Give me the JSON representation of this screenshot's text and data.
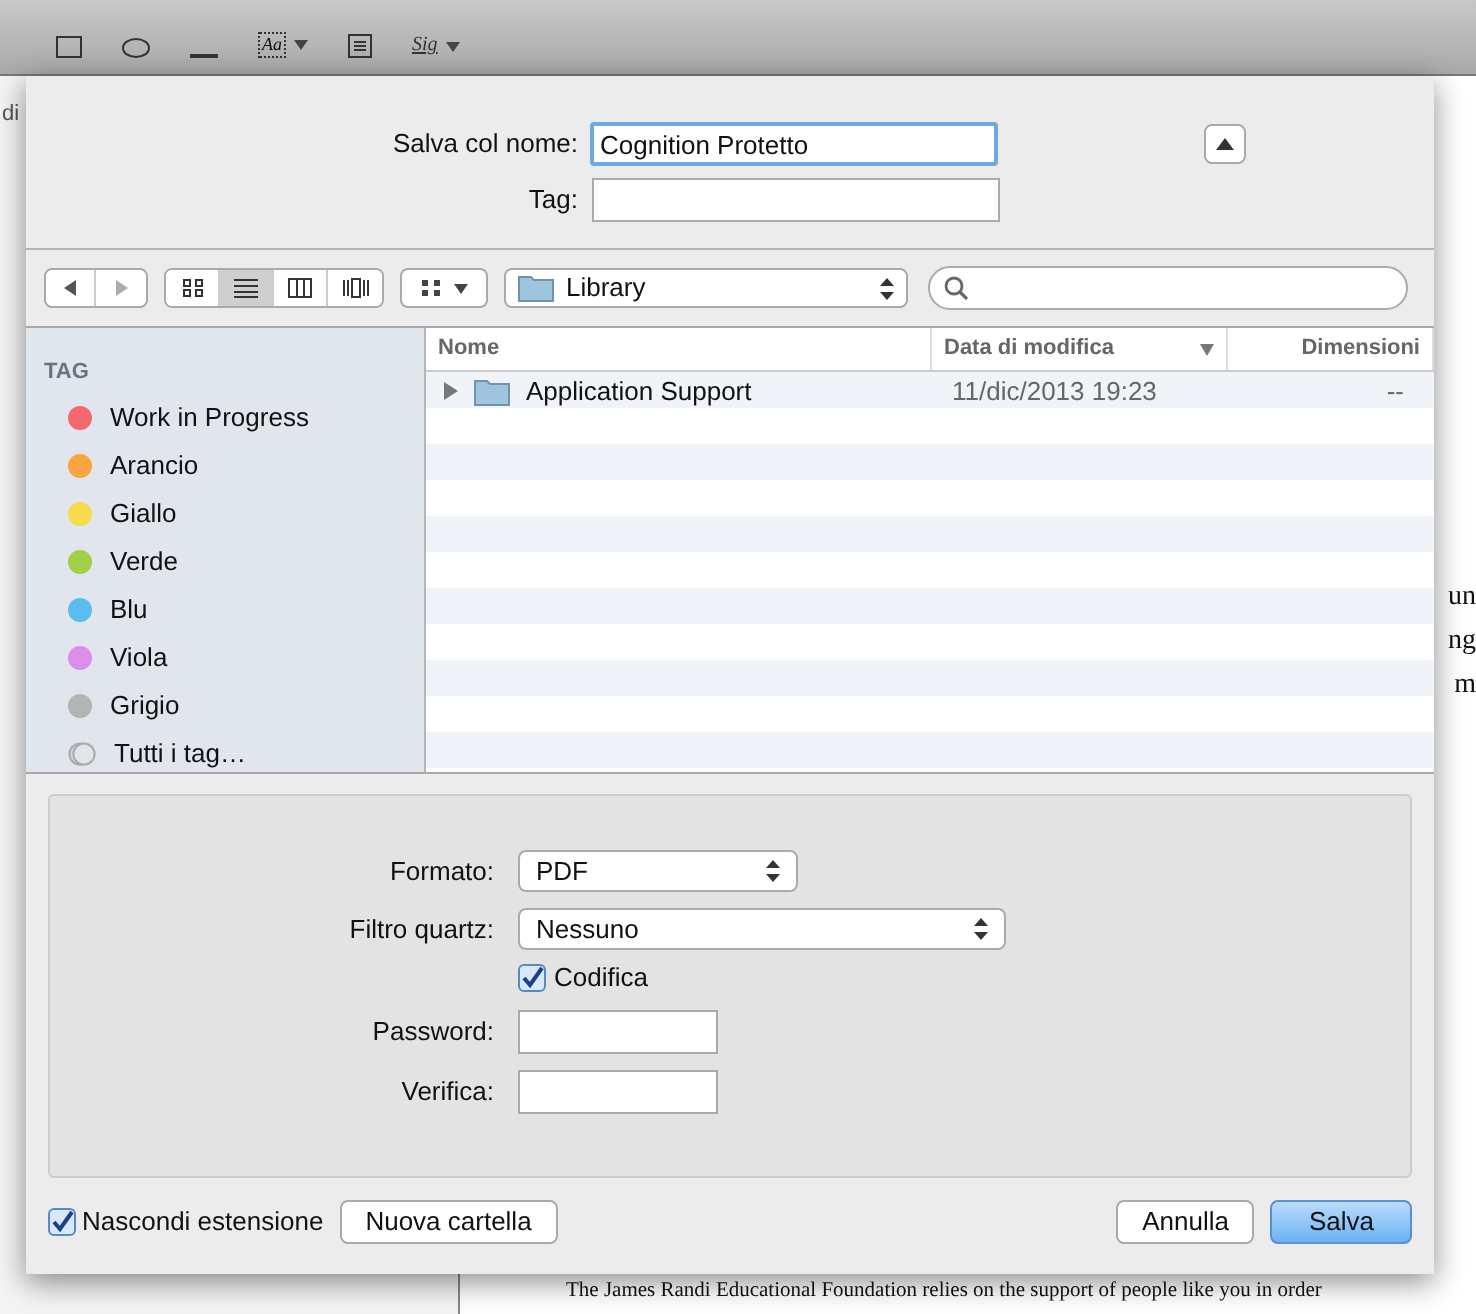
{
  "app_toolbar": {
    "text_tool": "Aa",
    "signature_tool": "Sig"
  },
  "document": {
    "sidebar_fragment": "di",
    "right_fragments": [
      "un",
      "ng",
      "m"
    ],
    "footer_line": "The James Randi Educational Foundation relies on the support of people like you in order"
  },
  "dialog": {
    "name_label": "Salva col nome:",
    "name_value": "Cognition Protetto",
    "tag_label": "Tag:",
    "view_modes": [
      {
        "kind": "icons",
        "selected": false
      },
      {
        "kind": "list",
        "selected": true
      },
      {
        "kind": "columns",
        "selected": false
      },
      {
        "kind": "coverflow",
        "selected": false
      }
    ],
    "location": "Library",
    "sidebar": {
      "heading": "TAG",
      "items": [
        {
          "label": "Work in Progress",
          "color": "#f26a6f",
          "kind": "tag"
        },
        {
          "label": "Arancio",
          "color": "#f9a43f",
          "kind": "tag"
        },
        {
          "label": "Giallo",
          "color": "#f7db4b",
          "kind": "tag"
        },
        {
          "label": "Verde",
          "color": "#a3cf48",
          "kind": "tag"
        },
        {
          "label": "Blu",
          "color": "#5bbcf2",
          "kind": "tag"
        },
        {
          "label": "Viola",
          "color": "#dd8ee9",
          "kind": "tag"
        },
        {
          "label": "Grigio",
          "color": "#b4b4b4",
          "kind": "tag"
        },
        {
          "label": "Tutti i tag…",
          "kind": "all"
        }
      ]
    },
    "columns": [
      {
        "label": "Nome",
        "sorted": false
      },
      {
        "label": "Data di modifica",
        "sorted": true
      },
      {
        "label": "Dimensioni",
        "sorted": false
      }
    ],
    "rows": [
      {
        "name": "Application Support",
        "modified": "11/dic/2013 19:23",
        "size": "--",
        "expanded": false
      }
    ],
    "options": {
      "format_label": "Formato:",
      "format": "PDF",
      "filter_label": "Filtro quartz:",
      "filter": "Nessuno",
      "encrypt": {
        "label": "Codifica",
        "checked": true
      },
      "password_label": "Password:",
      "verify_label": "Verifica:"
    },
    "hide_extension": {
      "label": "Nascondi estensione",
      "checked": true
    },
    "buttons": [
      {
        "label": "Nuova cartella",
        "kind": "normal"
      },
      {
        "label": "Annulla",
        "kind": "normal"
      },
      {
        "label": "Salva",
        "kind": "default"
      }
    ]
  }
}
